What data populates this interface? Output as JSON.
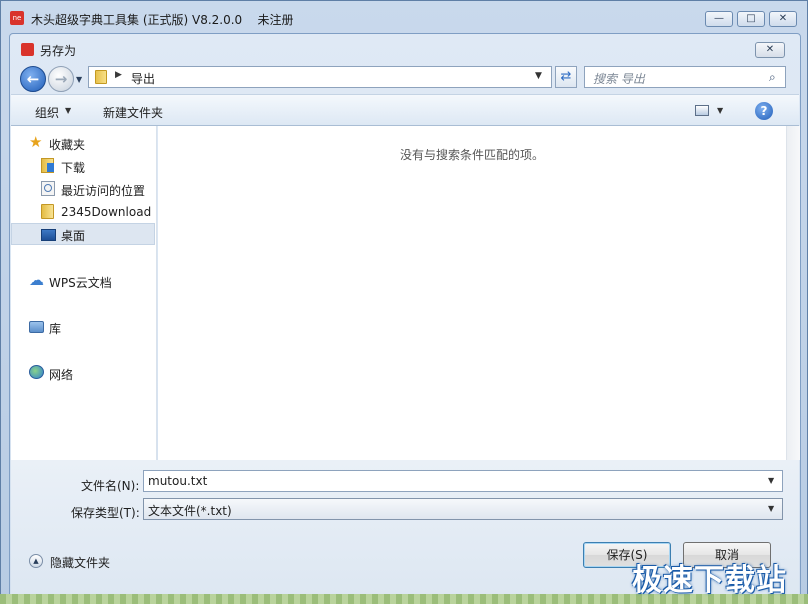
{
  "app": {
    "title": "木头超级字典工具集 (正式版) V8.2.0.0    未注册",
    "icon_text": "ne"
  },
  "dialog": {
    "title": "另存为",
    "address": {
      "path": "导出"
    },
    "search": {
      "placeholder": "搜索 导出"
    },
    "toolbar": {
      "organize": "组织",
      "new_folder": "新建文件夹"
    },
    "nav_items": [
      {
        "label": "收藏夹",
        "icon": "star-icon"
      },
      {
        "label": "下载",
        "icon": "downloads-folder-icon"
      },
      {
        "label": "最近访问的位置",
        "icon": "recent-places-icon"
      },
      {
        "label": "2345Download",
        "icon": "folder-icon"
      },
      {
        "label": "桌面",
        "icon": "desktop-icon",
        "selected": true
      },
      {
        "label": "WPS云文档",
        "icon": "cloud-icon"
      },
      {
        "label": "库",
        "icon": "library-icon"
      },
      {
        "label": "网络",
        "icon": "network-icon"
      }
    ],
    "empty_message": "没有与搜索条件匹配的项。",
    "form": {
      "filename_label": "文件名(N):",
      "filename_value": "mutou.txt",
      "filetype_label": "保存类型(T):",
      "filetype_value": "文本文件(*.txt)"
    },
    "hide_folders": "隐藏文件夹",
    "save_label": "保存(S)",
    "cancel_label": "取消"
  },
  "watermark": "极速下载站",
  "colors": {
    "accent": "#1f5db8",
    "folder": "#e4bc44",
    "watermark_outline": "#1a5ba8"
  }
}
